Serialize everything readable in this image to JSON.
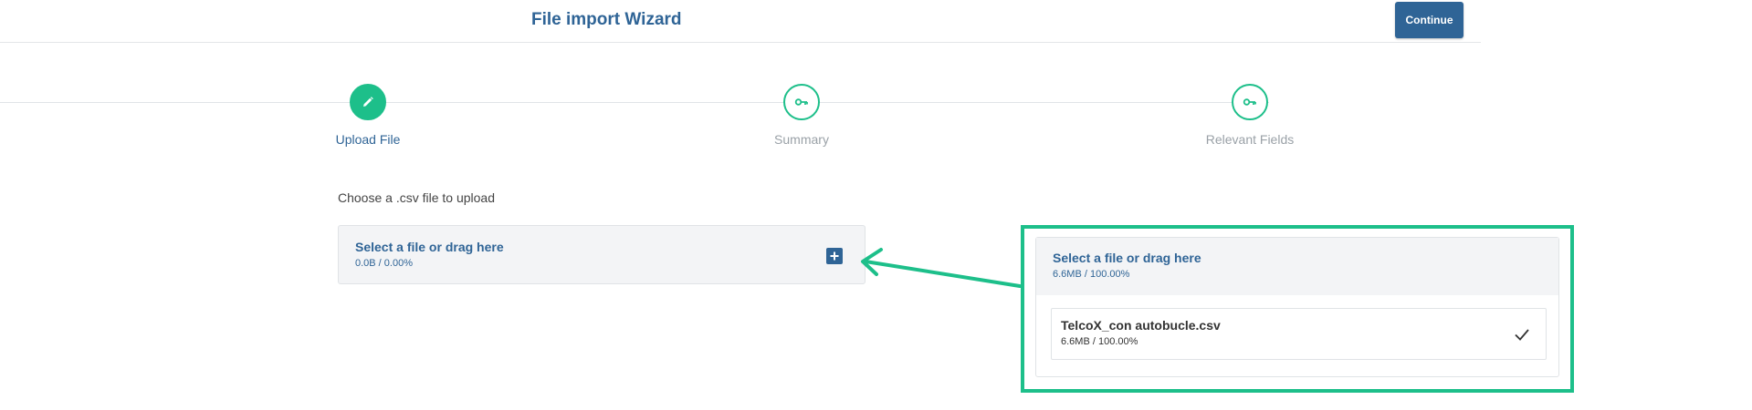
{
  "header": {
    "title": "File import Wizard",
    "continue_label": "Continue"
  },
  "stepper": {
    "steps": [
      {
        "label": "Upload File",
        "icon": "pencil-icon",
        "active": true
      },
      {
        "label": "Summary",
        "icon": "key-icon",
        "active": false
      },
      {
        "label": "Relevant Fields",
        "icon": "key-icon",
        "active": false
      }
    ]
  },
  "upload": {
    "instruction": "Choose a .csv file to upload",
    "title": "Select a file or drag here",
    "progress": "0.0B / 0.00%",
    "add_icon": "plus-icon"
  },
  "callout": {
    "title": "Select a file or drag here",
    "progress": "6.6MB / 100.00%",
    "file": {
      "name": "TelcoX_con autobucle.csv",
      "size": "6.6MB / 100.00%",
      "status_icon": "checkmark-icon"
    }
  },
  "colors": {
    "primary": "#2f6496",
    "accent": "#1dbf8a",
    "muted": "#9aa1a7",
    "panel": "#f3f4f6"
  }
}
